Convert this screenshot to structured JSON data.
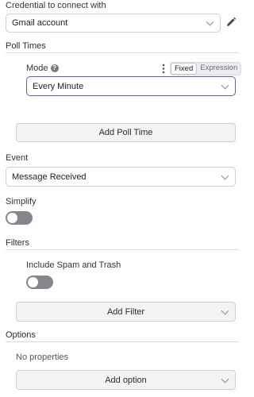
{
  "credential": {
    "label": "Credential to connect with",
    "value": "Gmail account"
  },
  "poll_times": {
    "title": "Poll Times",
    "mode_label": "Mode",
    "toggle_fixed": "Fixed",
    "toggle_expression": "Expression",
    "mode_value": "Every Minute",
    "add_button": "Add Poll Time"
  },
  "event": {
    "label": "Event",
    "value": "Message Received"
  },
  "simplify": {
    "label": "Simplify",
    "enabled": false
  },
  "filters": {
    "title": "Filters",
    "spam_label": "Include Spam and Trash",
    "spam_enabled": false,
    "add_button": "Add Filter"
  },
  "options": {
    "title": "Options",
    "empty_text": "No properties",
    "add_button": "Add option"
  },
  "colors": {
    "focus_border": "#6b5ba8",
    "toggle_off": "#85858d",
    "button_bg": "#f3f3f6"
  }
}
